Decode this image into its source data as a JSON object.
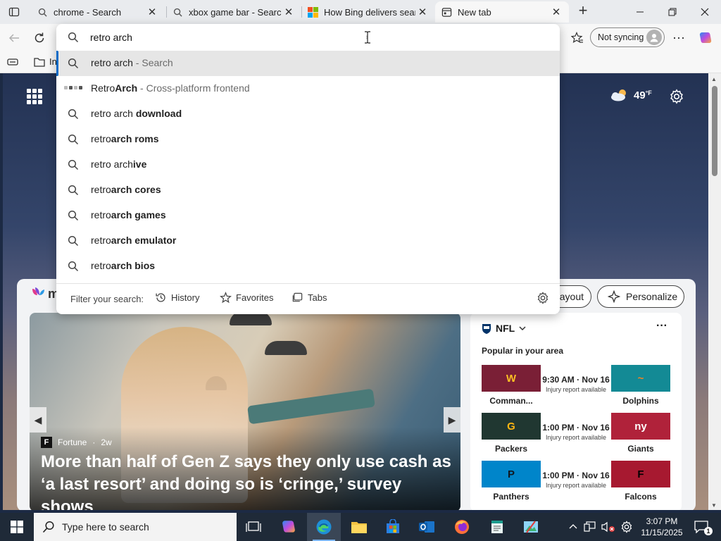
{
  "browser": {
    "tabs": [
      {
        "title": "chrome - Search",
        "icon": "search-icon"
      },
      {
        "title": "xbox game bar - Search",
        "icon": "search-icon"
      },
      {
        "title": "How Bing delivers search",
        "icon": "microsoft-icon"
      },
      {
        "title": "New tab",
        "icon": "newtab-icon"
      }
    ],
    "sync_label": "Not syncing",
    "favorites_partial": "In"
  },
  "omnibox": {
    "input_value": "retro arch",
    "suggestions": [
      {
        "pre": "retro arch",
        "bold": "",
        "post": " - Search",
        "kind": "search"
      },
      {
        "pre": "Retro",
        "bold": "Arch",
        "post": " - Cross-platform frontend",
        "kind": "site"
      },
      {
        "pre": "retro arch ",
        "bold": "download",
        "post": "",
        "kind": "search"
      },
      {
        "pre": "retro",
        "bold": "arch roms",
        "post": "",
        "kind": "search"
      },
      {
        "pre": "retro arch",
        "bold": "ive",
        "post": "",
        "kind": "search"
      },
      {
        "pre": "retro",
        "bold": "arch cores",
        "post": "",
        "kind": "search"
      },
      {
        "pre": "retro",
        "bold": "arch games",
        "post": "",
        "kind": "search"
      },
      {
        "pre": "retro",
        "bold": "arch emulator",
        "post": "",
        "kind": "search"
      },
      {
        "pre": "retro",
        "bold": "arch bios",
        "post": "",
        "kind": "search"
      }
    ],
    "filter_label": "Filter your search:",
    "filters": [
      "History",
      "Favorites",
      "Tabs"
    ]
  },
  "ntp": {
    "temperature": "49",
    "temp_unit": "°F",
    "feed_logo_partial": "m",
    "layout_label": "ayout",
    "personalize_label": "Personalize",
    "hero": {
      "source": "Fortune",
      "age": "2w",
      "headline": "More than half of Gen Z says they only use cash as ‘a last resort’ and doing so is ‘cringe,’ survey shows"
    },
    "nfl": {
      "title": "NFL",
      "subtitle": "Popular in your area",
      "games": [
        {
          "team_a": "Comman...",
          "team_b": "Dolphins",
          "time": "9:30 AM · Nov 16",
          "note": "Injury report available",
          "color_a": "#7a1f36",
          "color_b": "#138a95",
          "logo_a": "W",
          "logo_b": "~"
        },
        {
          "team_a": "Packers",
          "team_b": "Giants",
          "time": "1:00 PM · Nov 16",
          "note": "Injury report available",
          "color_a": "#203731",
          "color_b": "#b0223a",
          "logo_a": "G",
          "logo_b": "ny"
        },
        {
          "team_a": "Panthers",
          "team_b": "Falcons",
          "time": "1:00 PM · Nov 16",
          "note": "Injury report available",
          "color_a": "#0085ca",
          "color_b": "#a71930",
          "logo_a": "P",
          "logo_b": "F"
        }
      ]
    }
  },
  "taskbar": {
    "search_placeholder": "Type here to search",
    "time": "3:07 PM",
    "date": "11/15/2025",
    "notification_count": "1"
  },
  "colors": {
    "accent": "#0c6bc7",
    "taskbar": "#1f2a38"
  }
}
